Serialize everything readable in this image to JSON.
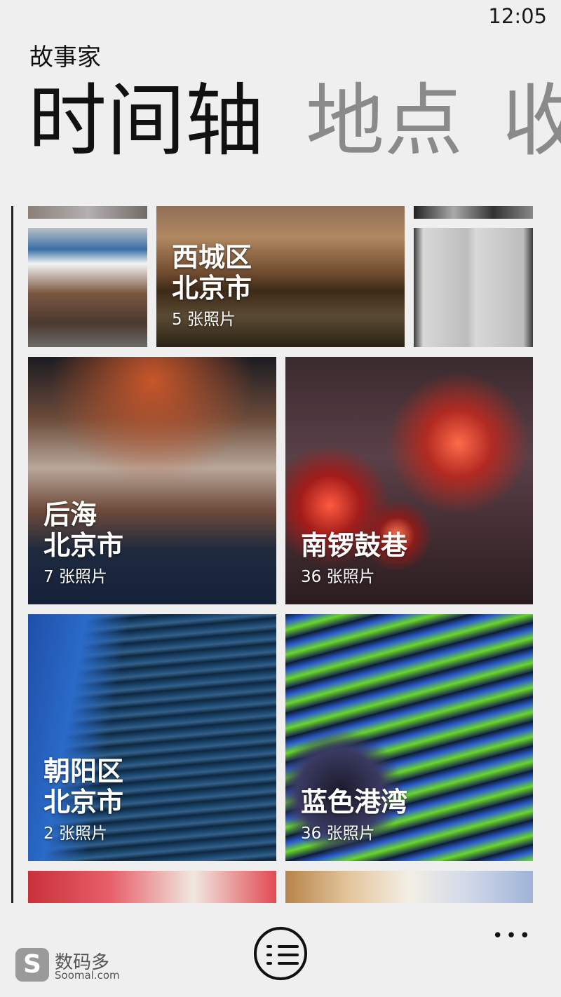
{
  "status_bar": {
    "time": "12:05"
  },
  "app": {
    "title": "故事家"
  },
  "pivot": {
    "tabs": [
      {
        "label": "时间轴",
        "active": true
      },
      {
        "label": "地点",
        "active": false
      },
      {
        "label": "收",
        "active": false
      }
    ]
  },
  "tiles": [
    {
      "id": "shop",
      "photo": "street-shop-photo"
    },
    {
      "id": "xicheng",
      "title_line1": "西城区",
      "title_line2": "北京市",
      "count": "5 张照片",
      "photo": "forbidden-city-photo"
    },
    {
      "id": "speakers",
      "photo": "speakers-photo"
    },
    {
      "id": "houhai",
      "title_line1": "后海",
      "title_line2": "北京市",
      "count": "7 张照片",
      "photo": "souvenir-shop-photo"
    },
    {
      "id": "nanluoguxiang",
      "title_line1": "南锣鼓巷",
      "count": "36 张照片",
      "photo": "lanterns-photo"
    },
    {
      "id": "chaoyang",
      "title_line1": "朝阳区",
      "title_line2": "北京市",
      "count": "2 张照片",
      "photo": "skyscraper-photo"
    },
    {
      "id": "lansegangwan",
      "title_line1": "蓝色港湾",
      "count": "36 张照片",
      "photo": "light-sculpture-photo"
    }
  ],
  "app_bar": {
    "list_icon": "list-check-icon",
    "more_icon": "more-dots-icon",
    "more_label": "•••"
  },
  "watermark": {
    "logo_letter": "S",
    "name_cn": "数码多",
    "name_en": "Soomal.com"
  }
}
